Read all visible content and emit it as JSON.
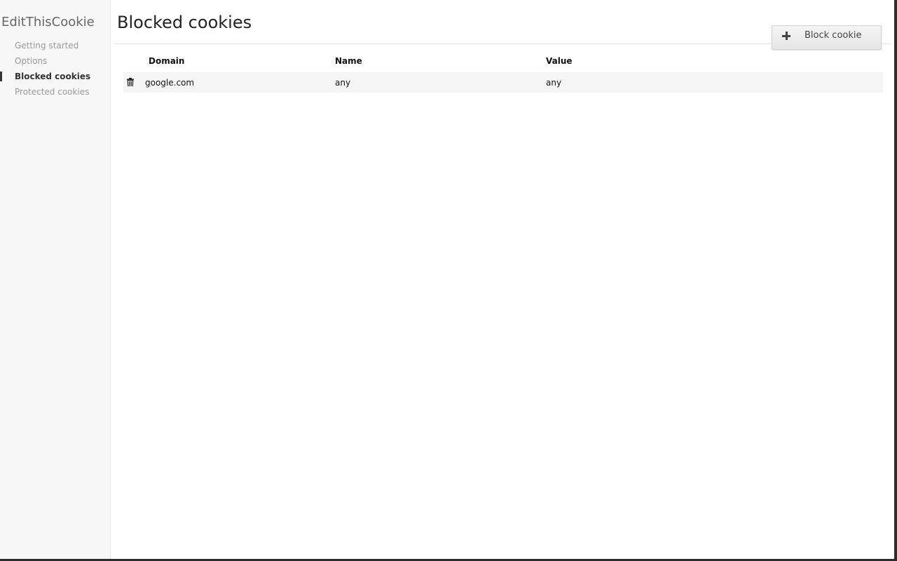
{
  "app": {
    "title": "EditThisCookie"
  },
  "sidebar": {
    "items": [
      {
        "label": "Getting started",
        "active": false
      },
      {
        "label": "Options",
        "active": false
      },
      {
        "label": "Blocked cookies",
        "active": true
      },
      {
        "label": "Protected cookies",
        "active": false
      }
    ]
  },
  "main": {
    "title": "Blocked cookies",
    "block_button": {
      "icon": "plus-icon",
      "label": "Block cookie"
    },
    "table": {
      "headers": {
        "domain": "Domain",
        "name": "Name",
        "value": "Value"
      },
      "rows": [
        {
          "delete_icon": "trash-icon",
          "domain": "google.com",
          "name": "any",
          "value": "any"
        }
      ]
    }
  },
  "colors": {
    "sidebar_bg": "#f7f7f7",
    "active_indicator": "#333333",
    "row_bg": "#f5f5f5"
  }
}
